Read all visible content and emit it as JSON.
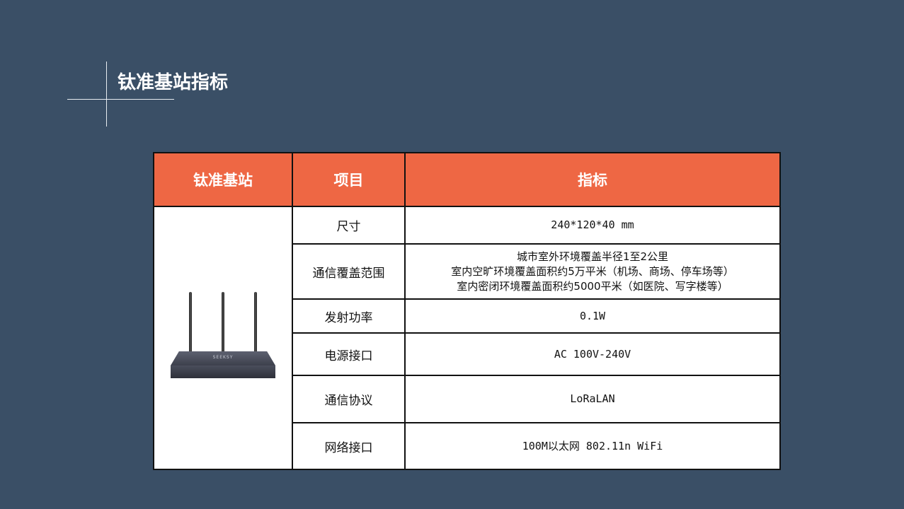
{
  "page": {
    "title": "钛准基站指标"
  },
  "table": {
    "headers": [
      "钛准基站",
      "项目",
      "指标"
    ],
    "device_logo_text": "SEEKSY",
    "rows": [
      {
        "item": "尺寸",
        "lines": [
          "240*120*40 mm"
        ]
      },
      {
        "item": "通信覆盖范围",
        "lines": [
          "城市室外环境覆盖半径1至2公里",
          "室内空旷环境覆盖面积约5万平米（机场、商场、停车场等）",
          "室内密闭环境覆盖面积约5000平米（如医院、写字楼等）"
        ]
      },
      {
        "item": "发射功率",
        "lines": [
          "0.1W"
        ]
      },
      {
        "item": "电源接口",
        "lines": [
          "AC 100V-240V"
        ]
      },
      {
        "item": "通信协议",
        "lines": [
          "LoRaLAN"
        ]
      },
      {
        "item": "网络接口",
        "lines": [
          "100M以太网 802.11n WiFi"
        ]
      }
    ]
  },
  "colors": {
    "background": "#3a4f66",
    "header_fill": "#ee6744",
    "border": "#111111"
  },
  "icons": [
    "router-image"
  ]
}
